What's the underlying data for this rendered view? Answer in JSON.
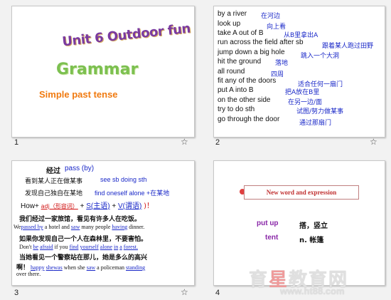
{
  "slides": [
    {
      "number": "1",
      "title": "Unit 6 Outdoor fun",
      "heading": "Grammar",
      "subtitle": "Simple past tense"
    },
    {
      "number": "2",
      "phrases": [
        {
          "en": "by a river",
          "zh": "在河边"
        },
        {
          "en": "look up",
          "zh": "向上看"
        },
        {
          "en": "take A out of B",
          "zh": "从B里拿出A"
        },
        {
          "en": "run across the field after sb",
          "zh": "跟着某人跑过田野"
        },
        {
          "en": "jump down a big hole",
          "zh": "跳入一个大洞"
        },
        {
          "en": "hit the ground",
          "zh": "落地"
        },
        {
          "en": "all round",
          "zh": "四周"
        },
        {
          "en": "fit any of the doors",
          "zh": "适合任何一扇门"
        },
        {
          "en": "put A into B",
          "zh": "把A放在B里"
        },
        {
          "en": "on the other side",
          "zh": "在另一边/面"
        },
        {
          "en": "try to do sth",
          "zh": "试图/努力做某事"
        },
        {
          "en": "go through the door",
          "zh": "通过那扇门"
        }
      ]
    },
    {
      "number": "3",
      "title": "经过",
      "title_en": "pass (by)",
      "line1_zh": "看到某人正在做某事",
      "line1_en": "see sb doing sth",
      "line2_zh": "发现自己独自在某地",
      "line2_en": "find oneself alone +在某地",
      "how_prefix": "How+",
      "how_adj": "adj（形容词）",
      "how_plus": "+",
      "how_s": "S(主语)",
      "how_plus2": "+",
      "how_v": "V(谓语)",
      "how_end": ")！",
      "s1_zh": "我们经过一家旅馆，看见有许多人在吃饭。",
      "s1_en": [
        "We",
        "passed by",
        "a hotel and",
        "saw",
        "many people",
        "having",
        "dinner."
      ],
      "s2_zh": "如果你发现自己一个人在森林里，不要害怕。",
      "s2_en": [
        "Don't",
        "be",
        "afraid",
        "if you",
        "find",
        "yourself",
        "alone",
        "in",
        "a",
        "forest."
      ],
      "s3_zh": "当她看见一个警察站在那儿，她是多么的高兴",
      "s3_zh_pre": "啊！",
      "s3_en": [
        "happy",
        "she",
        "was",
        "when she",
        "saw",
        "a policeman",
        "standing"
      ],
      "s3_en_end": "over there."
    },
    {
      "number": "4",
      "box_title": "New word and expression",
      "words": [
        {
          "en": "put up",
          "zh": "搭，竖立"
        },
        {
          "en": "tent",
          "zh": "n. 帐篷"
        }
      ]
    }
  ],
  "star_glyph": "☆",
  "watermark": {
    "text_a": "育",
    "text_star": "星",
    "text_b": "教育网",
    "url": "www.ht88.com"
  }
}
